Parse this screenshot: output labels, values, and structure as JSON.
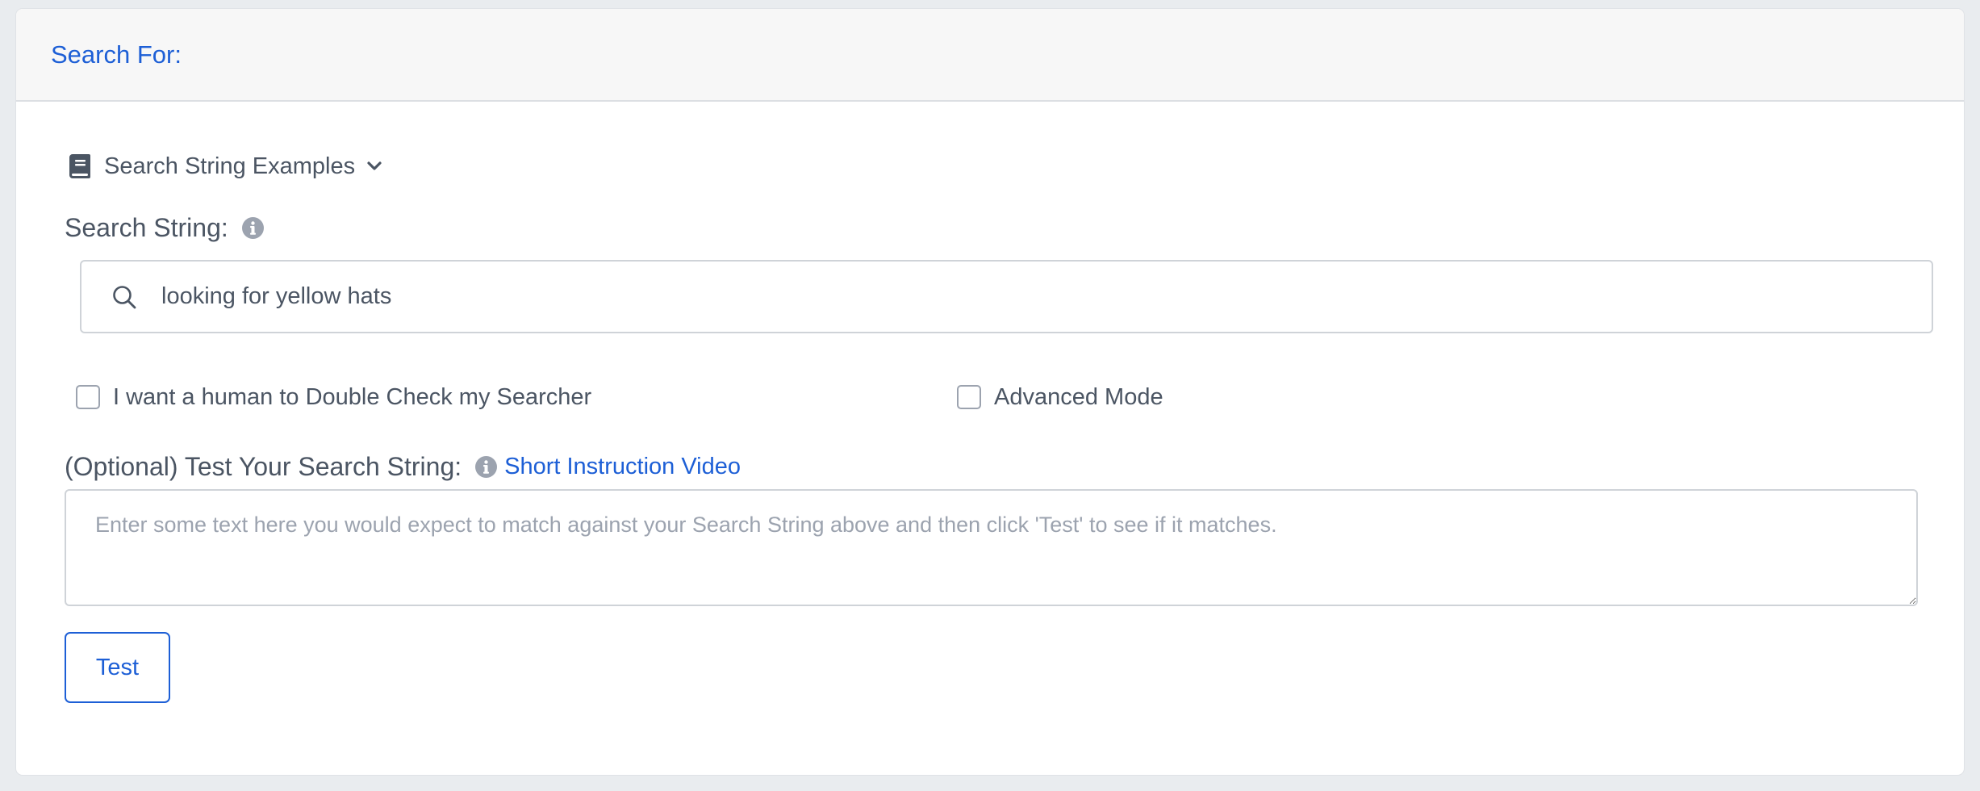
{
  "card": {
    "title": "Search For:"
  },
  "examples": {
    "label": "Search String Examples",
    "icon": "book-icon",
    "chevron": "chevron-down-icon"
  },
  "search": {
    "label": "Search String:",
    "info_icon": "info-icon",
    "value": "looking for yellow hats",
    "icon": "search-icon"
  },
  "options": {
    "human_check_label": "I want a human to Double Check my Searcher",
    "human_check_checked": false,
    "advanced_mode_label": "Advanced Mode",
    "advanced_mode_checked": false
  },
  "test": {
    "label": "(Optional) Test Your Search String:",
    "info_icon": "info-icon",
    "video_link": "Short Instruction Video",
    "placeholder": "Enter some text here you would expect to match against your Search String above and then click 'Test' to see if it matches.",
    "button_label": "Test"
  },
  "colors": {
    "accent": "#1d5fd6",
    "text": "#4b5563",
    "muted_icon": "#9ca3af",
    "header_bg": "#f7f7f7",
    "page_bg": "#e9ecef"
  }
}
